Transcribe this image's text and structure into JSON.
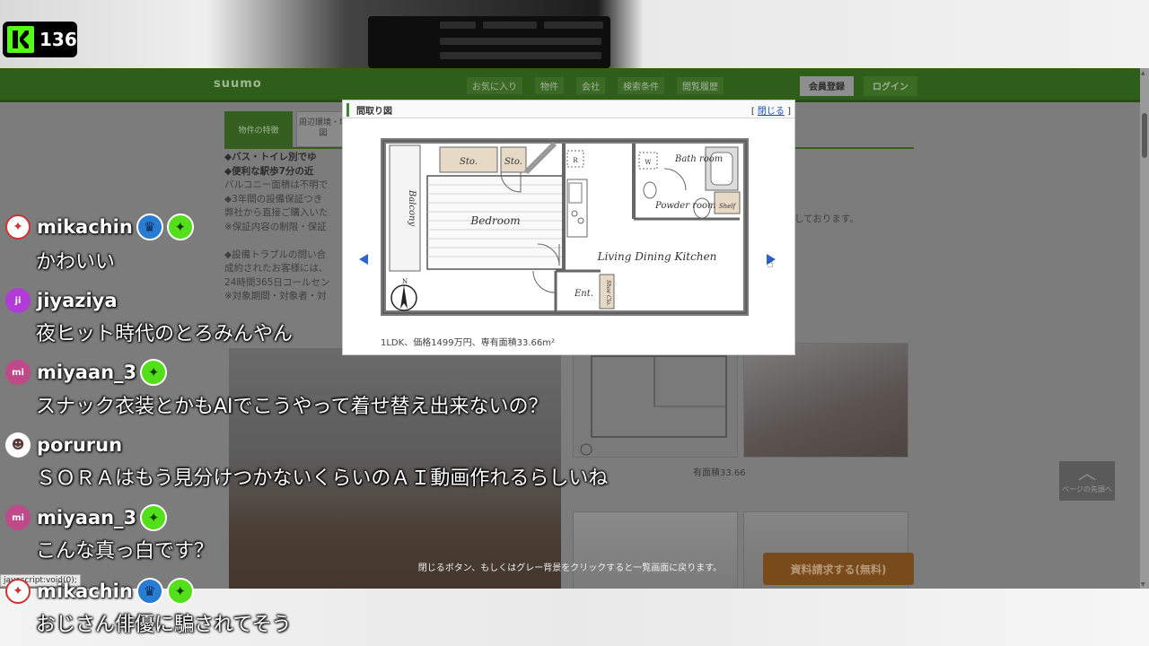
{
  "stream": {
    "viewer_count": "136"
  },
  "site": {
    "logo": "suumo",
    "nav_items": [
      "お気に入り",
      "物件",
      "会社",
      "検索条件",
      "閲覧履歴"
    ],
    "register_label": "会員登録",
    "login_label": "ログイン",
    "tab_active": "物件の特徴",
    "tab_inactive": "周辺環境・地図",
    "feature_lines": [
      "◆バス・トイレ別でゆ",
      "◆便利な駅歩7分の近",
      "バルコニー面積は不明で",
      "◆3年間の設備保証つき",
      "弊社から直接ご購入いた",
      "※保証内容の制限・保証",
      "",
      "◆設備トラブルの問い合",
      "成約されたお客様には、",
      "24時間365日コールセン",
      "※対象期間・対象者・対"
    ],
    "feature_right": "しております。",
    "thumb_caption": "有面積33.66",
    "page_top_label": "ページの先頭へ",
    "request_button": "資料請求する(無料)",
    "close_hint": "閉じるボタン、もしくはグレー背景をクリックすると一覧画面に戻ります。",
    "status_link": "javascript:void(0);"
  },
  "modal": {
    "title": "間取り図",
    "close_label": "閉じる",
    "close_bracket_open": "[",
    "close_bracket_close": "]",
    "caption": "1LDK、価格1499万円、専有面積33.66m²",
    "plan_labels": {
      "balcony": "Balcony",
      "bedroom": "Bedroom",
      "storage1": "Sto.",
      "storage2": "Sto.",
      "refrigerator": "R",
      "washer": "W",
      "bathroom": "Bath room",
      "powder_room": "Powder room",
      "shelf": "Shelf",
      "living": "Living Dining Kitchen",
      "entrance": "Ent.",
      "shoe_closet": "Shoe Clo.",
      "north": "N"
    }
  },
  "chat": [
    {
      "user": "mikachin",
      "avatar_color": "#c33",
      "avatar_text": "",
      "badges": [
        "moderator",
        "subscriber"
      ],
      "text": "かわいい"
    },
    {
      "user": "jiyaziya",
      "avatar_color": "#b03bd6",
      "avatar_text": "ji",
      "badges": [],
      "text": "夜ヒット時代のとろみんやん"
    },
    {
      "user": "miyaan_3",
      "avatar_color": "#c0498a",
      "avatar_text": "mi",
      "badges": [
        "subscriber"
      ],
      "text": "スナック衣装とかもAIでこうやって着せ替え出来ないの？"
    },
    {
      "user": "porurun",
      "avatar_color": "#5a3a3a",
      "avatar_text": "",
      "badges": [],
      "text": "ＳＯＲＡはもう見分けつかないくらいのＡＩ動画作れるらしいね"
    },
    {
      "user": "miyaan_3",
      "avatar_color": "#c0498a",
      "avatar_text": "mi",
      "badges": [
        "subscriber"
      ],
      "text": "こんな真っ白です？"
    },
    {
      "user": "mikachin",
      "avatar_color": "#c33",
      "avatar_text": "",
      "badges": [
        "moderator",
        "subscriber"
      ],
      "text": "おじさん俳優に騙されてそう"
    }
  ],
  "colors": {
    "kick_green": "#53fc18",
    "suumo_green": "#2f5e1a",
    "modal_arrow": "#2a64c6",
    "subscriber_badge": "#53e01a",
    "moderator_badge": "#2a7bd2"
  }
}
